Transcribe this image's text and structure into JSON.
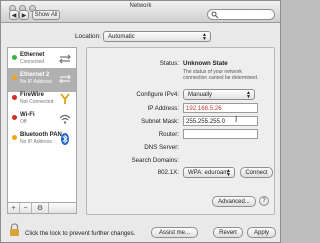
{
  "window": {
    "title": "Network"
  },
  "toolbar": {
    "back_label": "◀",
    "forward_label": "▶",
    "show_all_label": "Show All",
    "search_placeholder": ""
  },
  "location": {
    "label": "Location:",
    "value": "Automatic"
  },
  "sidebar": {
    "items": [
      {
        "name": "Ethernet",
        "status": "Connected",
        "status_color": "#33b54a"
      },
      {
        "name": "Ethernet 2",
        "status": "No IP Address",
        "status_color": "#f1a21b"
      },
      {
        "name": "FireWire",
        "status": "Not Connected",
        "status_color": "#d62d20"
      },
      {
        "name": "Wi-Fi",
        "status": "Off",
        "status_color": "#d62d20"
      },
      {
        "name": "Bluetooth PAN",
        "status": "No IP Address",
        "status_color": "#f1a21b"
      }
    ],
    "footer": {
      "add_label": "+",
      "remove_label": "−",
      "gear_label": "⚙"
    }
  },
  "details": {
    "status_label": "Status:",
    "status_value": "Unknown State",
    "status_note": "The status of your network connection cannot be determined.",
    "configure_label": "Configure IPv4:",
    "configure_value": "Manually",
    "ip_label": "IP Address:",
    "ip_value": "192.168.5.26",
    "subnet_label": "Subnet Mask:",
    "subnet_value": "255.255.255.0",
    "router_label": "Router:",
    "router_value": "",
    "dns_label": "DNS Server:",
    "dns_value": "",
    "search_domains_label": "Search Domains:",
    "search_domains_value": "",
    "dot1x_label": "802.1X:",
    "dot1x_value": "WPA: eduroam",
    "connect_label": "Connect",
    "advanced_label": "Advanced...",
    "help_label": "?"
  },
  "footer": {
    "lock_text": "Click the lock to prevent further changes.",
    "assist_label": "Assist me...",
    "revert_label": "Revert",
    "apply_label": "Apply"
  },
  "colors": {
    "ip_text": "#c0392b"
  }
}
